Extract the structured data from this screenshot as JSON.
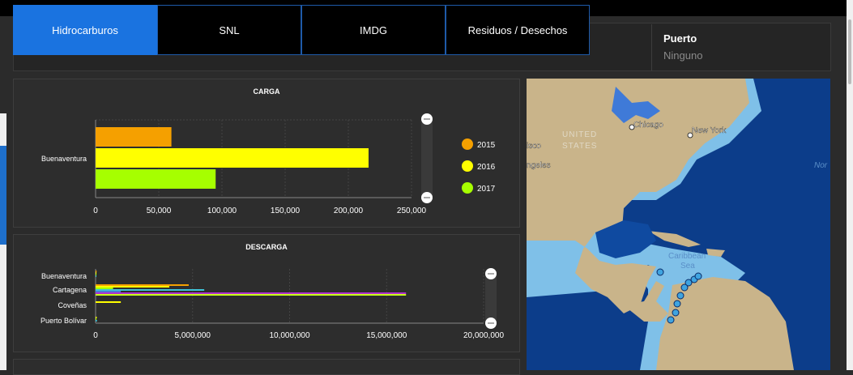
{
  "tabs": [
    {
      "label": "Hidrocarburos",
      "active": true
    },
    {
      "label": "SNL",
      "active": false
    },
    {
      "label": "IMDG",
      "active": false
    },
    {
      "label": "Residuos / Desechos",
      "active": false
    }
  ],
  "puerto": {
    "label": "Puerto",
    "value": "Ninguno"
  },
  "carga": {
    "title": "CARGA",
    "chart_data": {
      "type": "bar",
      "orientation": "horizontal",
      "categories": [
        "Buenaventura"
      ],
      "series": [
        {
          "name": "2015",
          "values": [
            60000
          ],
          "color": "#f5a000"
        },
        {
          "name": "2016",
          "values": [
            216000
          ],
          "color": "#ffff00"
        },
        {
          "name": "2017",
          "values": [
            95000
          ],
          "color": "#a6ff00"
        }
      ],
      "xlim": [
        0,
        250000
      ],
      "xticks": [
        "0",
        "50,000",
        "100,000",
        "150,000",
        "200,000",
        "250,000"
      ],
      "legend_position": "right",
      "grid": true
    }
  },
  "descarga": {
    "title": "DESCARGA",
    "chart_data": {
      "type": "bar",
      "orientation": "horizontal",
      "categories": [
        "Buenaventura",
        "Cartagena",
        "Coveñas",
        "Puerto Bolívar"
      ],
      "series": [
        {
          "values": [
            50000,
            4800000,
            0,
            0
          ],
          "color": "#f5a000"
        },
        {
          "values": [
            30000,
            3800000,
            1300000,
            60000
          ],
          "color": "#ffff00"
        },
        {
          "values": [
            20000,
            900000,
            0,
            40000
          ],
          "color": "#a6ff00"
        },
        {
          "values": [
            40000,
            5600000,
            0,
            70000
          ],
          "color": "#3fc4d8"
        },
        {
          "values": [
            0,
            1300000,
            0,
            0
          ],
          "color": "#4a7bd4"
        },
        {
          "values": [
            0,
            16000000,
            0,
            0
          ],
          "color": "#b030d0"
        },
        {
          "values": [
            0,
            16000000,
            0,
            0
          ],
          "color": "#c8ff1a"
        }
      ],
      "xlim": [
        0,
        20000000
      ],
      "xticks": [
        "0",
        "5,000,000",
        "10,000,000",
        "15,000,000",
        "20,000,000"
      ],
      "grid": true
    }
  },
  "map": {
    "labels": {
      "united_states": "UNITED",
      "united_states_2": "STATES",
      "chicago": "Chicago",
      "new_york": "New York",
      "caribbean": "Caribbean",
      "sea": "Sea",
      "cisco": "isco",
      "angeles": "ngeles",
      "nor": "Nor"
    },
    "colors": {
      "ocean_deep": "#0c3d8a",
      "ocean_shallow": "#7fc0e8",
      "land": "#c9b48a",
      "marker": "#3fa4e0"
    }
  }
}
